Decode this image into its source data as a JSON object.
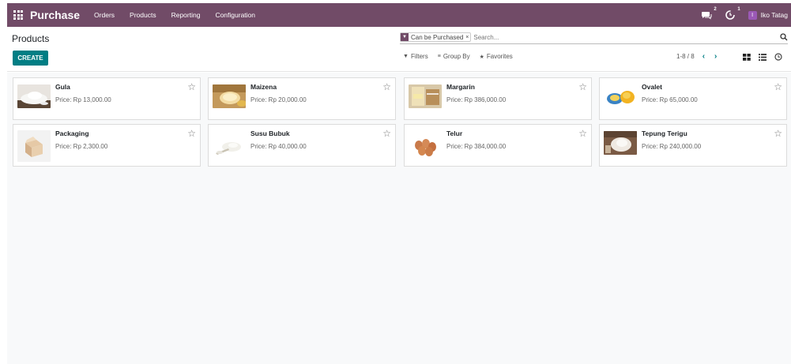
{
  "navbar": {
    "brand": "Purchase",
    "menu": [
      "Orders",
      "Products",
      "Reporting",
      "Configuration"
    ],
    "messages_badge": "2",
    "activities_badge": "1",
    "avatar_initial": "I",
    "username": "Iko Tatag",
    "color": "#714b67"
  },
  "control_panel": {
    "title": "Products",
    "create_label": "CREATE",
    "search": {
      "facet_value": "Can be Purchased",
      "facet_remove": "×",
      "placeholder": "Search..."
    },
    "filters_label": "Filters",
    "group_by_label": "Group By",
    "favorites_label": "Favorites",
    "pager": "1-8 / 8",
    "accent": "#017e84"
  },
  "products": [
    {
      "name": "Gula",
      "price": "Price: Rp 13,000.00",
      "icon": "sugar-image"
    },
    {
      "name": "Maizena",
      "price": "Price: Rp 20,000.00",
      "icon": "cornstarch-image"
    },
    {
      "name": "Margarin",
      "price": "Price: Rp 386,000.00",
      "icon": "margarine-image"
    },
    {
      "name": "Ovalet",
      "price": "Price: Rp 65,000.00",
      "icon": "ovalet-image"
    },
    {
      "name": "Packaging",
      "price": "Price: Rp 2,300.00",
      "icon": "packaging-image"
    },
    {
      "name": "Susu Bubuk",
      "price": "Price: Rp 40,000.00",
      "icon": "milk-powder-image"
    },
    {
      "name": "Telur",
      "price": "Price: Rp 384,000.00",
      "icon": "eggs-image"
    },
    {
      "name": "Tepung Terigu",
      "price": "Price: Rp 240,000.00",
      "icon": "flour-image"
    }
  ]
}
